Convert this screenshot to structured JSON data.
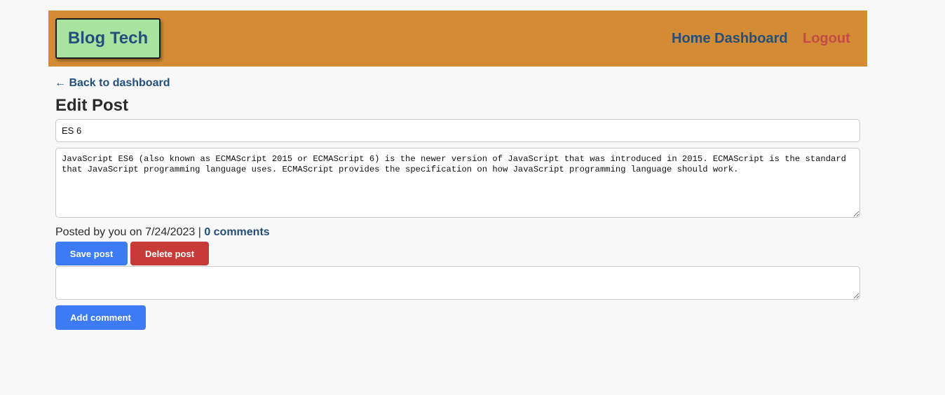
{
  "header": {
    "brand": "Blog Tech",
    "nav": {
      "home_dashboard": "Home Dashboard",
      "logout": "Logout"
    }
  },
  "main": {
    "back_link": "← Back to dashboard",
    "page_title": "Edit Post",
    "post_title_value": "ES 6",
    "post_body_value": "JavaScript ES6 (also known as ECMAScript 2015 or ECMAScript 6) is the newer version of JavaScript that was introduced in 2015. ECMAScript is the standard that JavaScript programming language uses. ECMAScript provides the specification on how JavaScript programming language should work.",
    "meta_prefix": "Posted by you on 7/24/2023 | ",
    "comments_link": "0 comments",
    "save_button": "Save post",
    "delete_button": "Delete post",
    "comment_value": "",
    "add_comment_button": "Add comment"
  },
  "colors": {
    "header_bg": "#d38b35",
    "brand_bg": "#a8e3a0",
    "link": "#234f7a",
    "logout": "#c44a4a",
    "primary_button": "#3d7bf5",
    "danger_button": "#c63b37",
    "page_bg": "#f8f8f8"
  }
}
